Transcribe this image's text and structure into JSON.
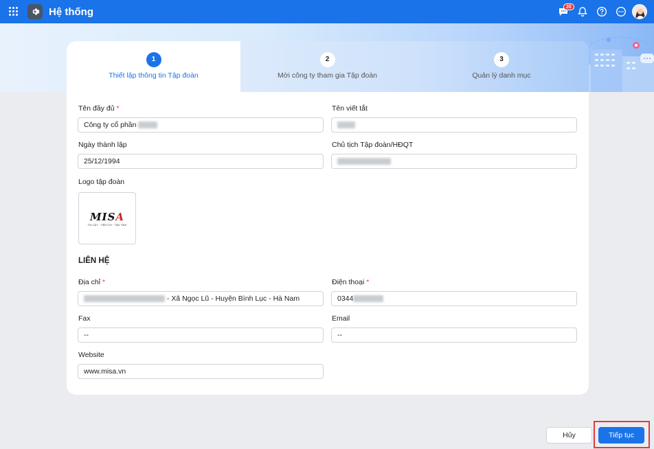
{
  "app": {
    "title": "Hệ thống",
    "notification_count": "20"
  },
  "steps": [
    {
      "number": "1",
      "label": "Thiết lập thông tin Tập đoàn",
      "active": true
    },
    {
      "number": "2",
      "label": "Mời công ty tham gia Tập đoàn",
      "active": false
    },
    {
      "number": "3",
      "label": "Quản lý danh mục",
      "active": false
    }
  ],
  "form": {
    "full_name_label": "Tên đầy đủ",
    "full_name_value": "Công ty cổ phần",
    "short_name_label": "Tên viết tắt",
    "short_name_value": "",
    "founded_label": "Ngày thành lập",
    "founded_value": "25/12/1994",
    "chairman_label": "Chủ tịch Tập đoàn/HĐQT",
    "chairman_value": "",
    "logo_label": "Logo tập đoàn",
    "logo_text": "MISA",
    "logo_tagline": "TIN CẬY · TIỆN ÍCH · TẬN TÌNH",
    "contact_section": "LIÊN HỆ",
    "address_label": "Địa chỉ",
    "address_value": "- Xã Ngọc Lũ - Huyện Bình Lục - Hà Nam",
    "phone_label": "Điện thoại",
    "phone_value": "0344",
    "fax_label": "Fax",
    "fax_value": "--",
    "email_label": "Email",
    "email_value": "--",
    "website_label": "Website",
    "website_value": "www.misa.vn",
    "required_mark": "*"
  },
  "footer": {
    "cancel_label": "Hủy",
    "next_label": "Tiếp tục"
  },
  "colors": {
    "primary": "#1a73e8",
    "required": "#e53935",
    "highlight": "#e53935"
  }
}
